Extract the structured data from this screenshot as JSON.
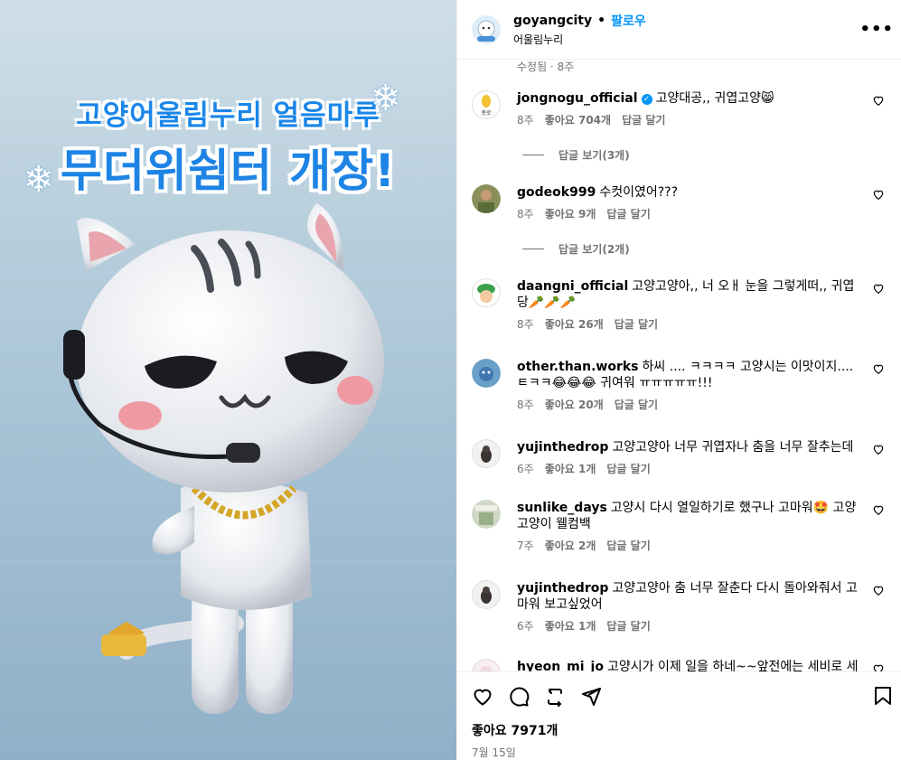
{
  "header": {
    "username": "goyangcity",
    "dot": "•",
    "follow": "팔로우",
    "location": "어울림누리",
    "more": "•••"
  },
  "media": {
    "title_line1": "고양어울림누리 얼음마루",
    "title_line2": "무더위쉼터 개장!"
  },
  "edited": "수정됨 · 8주",
  "comments": [
    {
      "user": "jongnogu_official",
      "verified": true,
      "text": "고양대공,, 귀엽고양😸",
      "time": "8주",
      "likes": "좋아요 704개",
      "reply": "답글 달기",
      "view_replies": "답글 보기(3개)"
    },
    {
      "user": "godeok999",
      "text": "수컷이였어???",
      "time": "8주",
      "likes": "좋아요 9개",
      "reply": "답글 달기",
      "view_replies": "답글 보기(2개)"
    },
    {
      "user": "daangni_official",
      "text": "고양고양아,, 너 오ㅐ 눈을 그렇게떠,, 귀엽당🥕🥕🥕",
      "time": "8주",
      "likes": "좋아요 26개",
      "reply": "답글 달기"
    },
    {
      "user": "other.than.works",
      "text": "하씨 .... ㅋㅋㅋㅋ 고양시는 이맛이지....ㅌㅋㅋ😂😂😂 귀여워 ㅠㅠㅠㅠㅠ!!!",
      "time": "8주",
      "likes": "좋아요 20개",
      "reply": "답글 달기"
    },
    {
      "user": "yujinthedrop",
      "text": "고양고양아 너무 귀엽자나 춤을 너무 잘추는데",
      "time": "6주",
      "likes": "좋아요 1개",
      "reply": "답글 달기"
    },
    {
      "user": "sunlike_days",
      "text": "고양시 다시 열일하기로 했구나 고마워🤩 고양고양이 웰컴백",
      "time": "7주",
      "likes": "좋아요 2개",
      "reply": "답글 달기"
    },
    {
      "user": "yujinthedrop",
      "text": "고양고양아 춤 너무 잘춘다 다시 돌아와줘서 고마워 보고싶었어",
      "time": "6주",
      "likes": "좋아요 1개",
      "reply": "답글 달기"
    },
    {
      "user": "hyeon_mi_jo",
      "text": "고양시가 이제 일을 하네~~앞전에는 세비로 세계속으로만 댕기시드만~고양고양시 잘 한다👏👏",
      "time": "",
      "likes": "",
      "reply": ""
    }
  ],
  "footer": {
    "likes": "좋아요 7971개",
    "date": "7월 15일"
  },
  "icons": [
    "heart-icon",
    "comment-icon",
    "share-icon",
    "send-icon",
    "bookmark-icon"
  ],
  "colors": {
    "accent": "#0095f6",
    "title_blue": "#1d84e6",
    "muted": "#737373"
  }
}
